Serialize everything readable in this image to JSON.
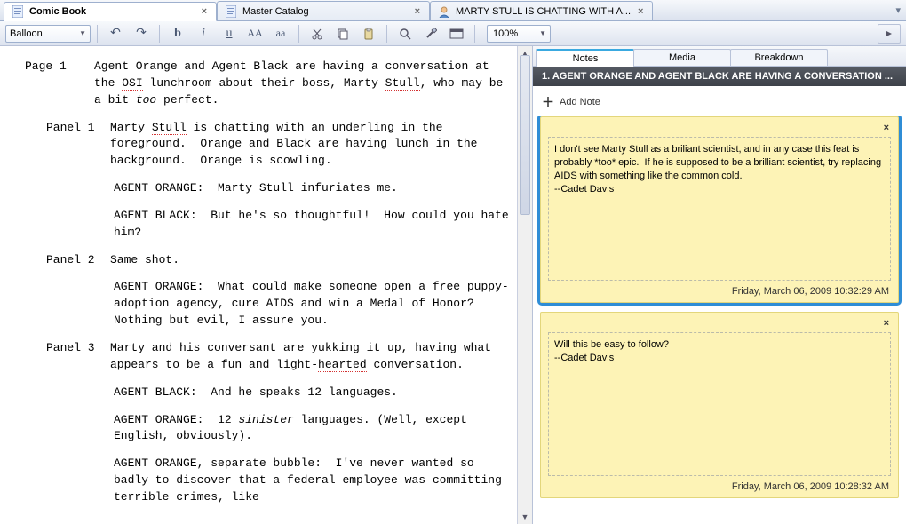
{
  "tabs": [
    {
      "label": "Comic Book",
      "icon": "doc",
      "active": true
    },
    {
      "label": "Master Catalog",
      "icon": "doc",
      "active": false
    },
    {
      "label": "MARTY STULL IS CHATTING WITH A...",
      "icon": "user",
      "active": false
    }
  ],
  "toolbar": {
    "style_label": "Balloon",
    "zoom_label": "100%",
    "undo": "↶",
    "redo": "↷",
    "bold": "b",
    "italic": "i",
    "underline": "u",
    "upper": "AA",
    "lower": "aa",
    "cut": "✂",
    "copy": "⧉",
    "paste": "📋",
    "find": "🔍",
    "tool": "🔧",
    "ruler": "▭"
  },
  "editor": {
    "page_label": "Page 1",
    "page_text": "Agent Orange and Agent Black are having a conversation at the ",
    "osi": "OSI",
    "page_text2": " lunchroom about their boss, Marty ",
    "stull": "Stull",
    "page_text3": ", who may be a bit ",
    "too": "too",
    "page_text4": " perfect.",
    "p1_label": "Panel 1",
    "p1_text": "Marty ",
    "p1_stull": "Stull",
    "p1_text2": " is chatting with an underling in the foreground.  Orange and Black are having lunch in the background.  Orange is scowling.",
    "p1_d1": "AGENT ORANGE:  Marty Stull infuriates me.",
    "p1_d2": "AGENT BLACK:  But he's so thoughtful!  How could you hate him?",
    "p2_label": "Panel 2",
    "p2_text": "Same shot.",
    "p2_d1a": "AGENT ORANGE:  What could make someone open a free puppy-adoption agency, cure AIDS and win a ",
    "p2_medal": "Medal",
    "p2_d1b": " of Honor?  Nothing but evil, I assure you.",
    "p3_label": "Panel 3",
    "p3_text": "Marty and his conversant are yukking it up, having what appears to be a fun and light-",
    "p3_hearted": "hearted",
    "p3_text2": " conversation.",
    "p3_d1": "AGENT BLACK:  And he speaks 12 languages.",
    "p3_d2a": "AGENT ORANGE:  12 ",
    "p3_sin": "sinister",
    "p3_d2b": " languages. (Well, except English, obviously).",
    "p3_d3": "AGENT ORANGE, separate bubble:  I've never wanted so badly to discover that a federal employee was committing terrible crimes, like"
  },
  "side": {
    "tabs": [
      "Notes",
      "Media",
      "Breakdown"
    ],
    "header": "1. AGENT ORANGE AND AGENT BLACK ARE HAVING A CONVERSATION ...",
    "add_label": "Add Note",
    "notes": [
      {
        "text": "I don't see Marty Stull as a briliant scientist, and in any case this feat is probably *too* epic.  If he is supposed to be a brilliant scientist, try replacing AIDS with something like the common cold.\n--Cadet Davis",
        "date": "Friday, March 06, 2009 10:32:29 AM",
        "selected": true
      },
      {
        "text": "Will this be easy to follow?\n--Cadet Davis",
        "date": "Friday, March 06, 2009 10:28:32 AM",
        "selected": false
      }
    ]
  }
}
